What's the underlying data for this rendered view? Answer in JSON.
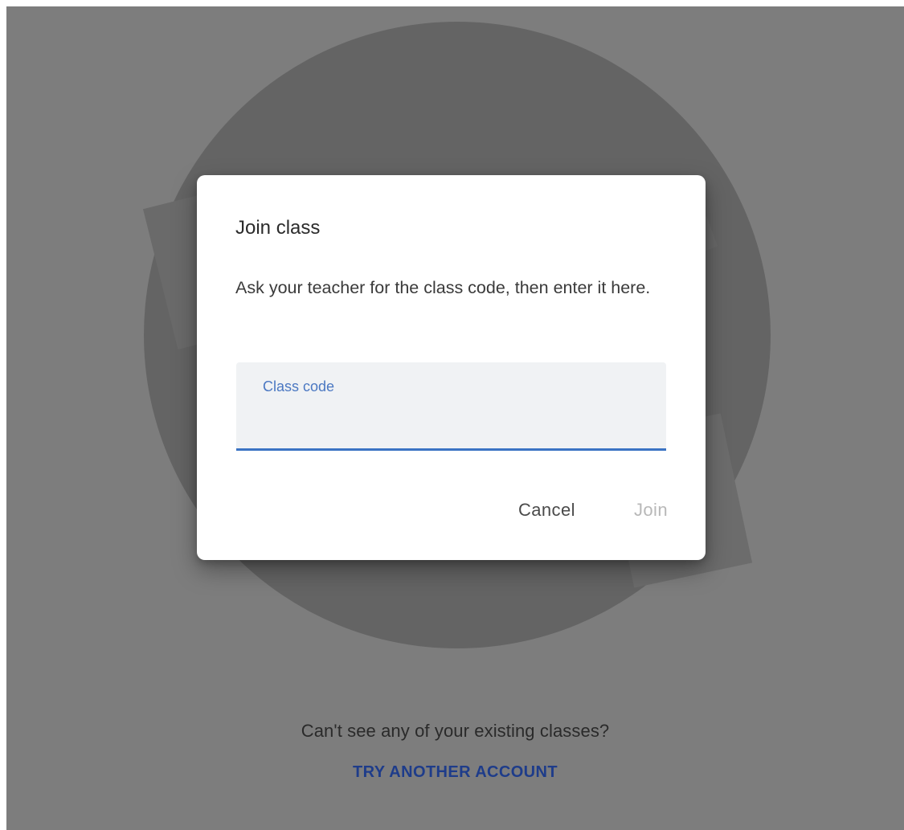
{
  "dialog": {
    "title": "Join class",
    "description": "Ask your teacher for the class code, then enter it here.",
    "field": {
      "label": "Class code",
      "value": ""
    },
    "cancel_label": "Cancel",
    "join_label": "Join"
  },
  "footer": {
    "question": "Can't see any of your existing classes?",
    "link_label": "TRY ANOTHER ACCOUNT"
  },
  "colors": {
    "scrim": "#7f7f7f",
    "field_underline": "#3b73c3",
    "link": "#1e3c8a",
    "join_disabled": "#b8b8b8"
  }
}
